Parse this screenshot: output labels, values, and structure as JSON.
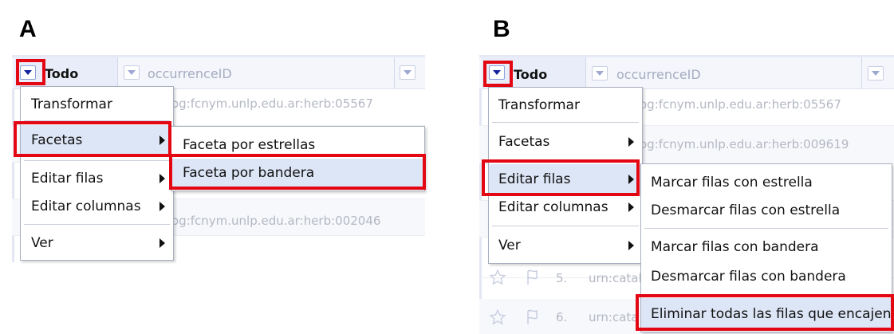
{
  "panels": {
    "a": {
      "label": "A",
      "columns": {
        "todo": "Todo",
        "occurrence": "occurrenceID"
      },
      "row_values": [
        "og:fcnym.unlp.edu.ar:herb:05567",
        "og:fcnym.unlp.edu.ar:herb:002046"
      ],
      "menu": {
        "items": [
          "Transformar",
          "Facetas",
          "Editar filas",
          "Editar columnas",
          "Ver"
        ]
      },
      "submenu": {
        "items": [
          "Faceta por estrellas",
          "Faceta por bandera"
        ]
      }
    },
    "b": {
      "label": "B",
      "columns": {
        "todo": "Todo",
        "occurrence": "occurrenceID"
      },
      "row_values": [
        "og:fcnym.unlp.edu.ar:herb:05567",
        "og:fcnym.unlp.edu.ar:herb:009619"
      ],
      "row_numbers": [
        "5.",
        "6."
      ],
      "row_partial": [
        "urn:catal",
        "urn:cata"
      ],
      "menu": {
        "items": [
          "Transformar",
          "Facetas",
          "Editar filas",
          "Editar columnas",
          "Ver"
        ]
      },
      "submenu": {
        "items": [
          "Marcar filas con estrella",
          "Desmarcar filas con estrella",
          "Marcar filas con bandera",
          "Desmarcar filas con bandera",
          "Eliminar todas las filas que encajen"
        ]
      }
    }
  },
  "colors": {
    "highlight": "#e30613",
    "menu_hover": "#dde6f6",
    "header_bg": "#f4f6fc",
    "active_arrow": "#12239c"
  },
  "icons": [
    "dropdown-arrow-icon",
    "submenu-arrow-icon",
    "star-icon",
    "flag-icon"
  ]
}
